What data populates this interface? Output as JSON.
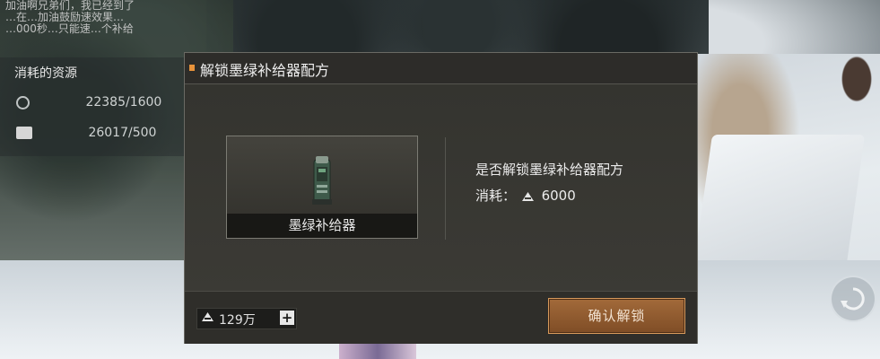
{
  "hud": {
    "tip_lines": [
      "加油啊兄弟们，我已经到了",
      "…在…加油鼓励速效果…",
      "…000秒…只能速…个补给"
    ],
    "resources_title": "消耗的资源",
    "resources": [
      {
        "icon": "gear-icon",
        "value": "22385/1600"
      },
      {
        "icon": "supply-box-icon",
        "value": "26017/500"
      }
    ]
  },
  "dialog": {
    "title": "解锁墨绿补给器配方",
    "item_name": "墨绿补给器",
    "confirm_question": "是否解锁墨绿补给器配方",
    "cost_label": "消耗：",
    "cost_icon": "material-icon",
    "cost_value": "6000",
    "balance_value": "129万",
    "plus_label": "+",
    "unlock_button": "确认解锁",
    "accent_color": "#e8923a",
    "button_color": "#a26a3a"
  }
}
